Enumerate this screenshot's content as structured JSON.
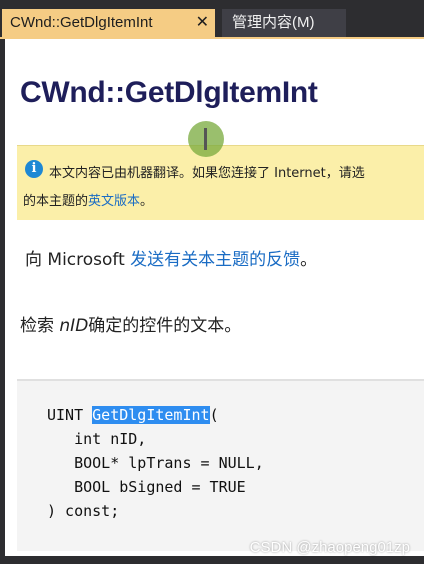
{
  "tabs": [
    {
      "label": "CWnd::GetDlgItemInt",
      "close": "✕",
      "active": true
    },
    {
      "label": "管理内容(M)",
      "active": false
    }
  ],
  "page": {
    "title": "CWnd::GetDlgItemInt",
    "notice": {
      "icon": "info-icon",
      "line1": "本文内容已由机器翻译。如果您连接了 Internet，请选",
      "line2_prefix": "的本主题的",
      "line2_link": "英文版本",
      "line2_suffix": "。"
    },
    "feedback": {
      "prefix": "向 Microsoft ",
      "link": "发送有关本主题的反馈",
      "suffix": "。"
    },
    "description": {
      "prefix": "检索 ",
      "param": "nID",
      "suffix": "确定的控件的文本。"
    },
    "code": {
      "line1_type": "UINT ",
      "line1_name": "GetDlgItemInt",
      "line1_paren": "(",
      "line2": "   int nID,",
      "line3": "   BOOL* lpTrans = NULL,",
      "line4": "   BOOL bSigned = TRUE",
      "line5": ") const;"
    }
  },
  "watermark": "CSDN @zhaopeng01zp",
  "colors": {
    "active_tab": "#f5cc84",
    "title": "#1e1e5a",
    "notice_bg": "#fbefa9",
    "link": "#1a6cc4",
    "highlight": "#2e8df0"
  }
}
